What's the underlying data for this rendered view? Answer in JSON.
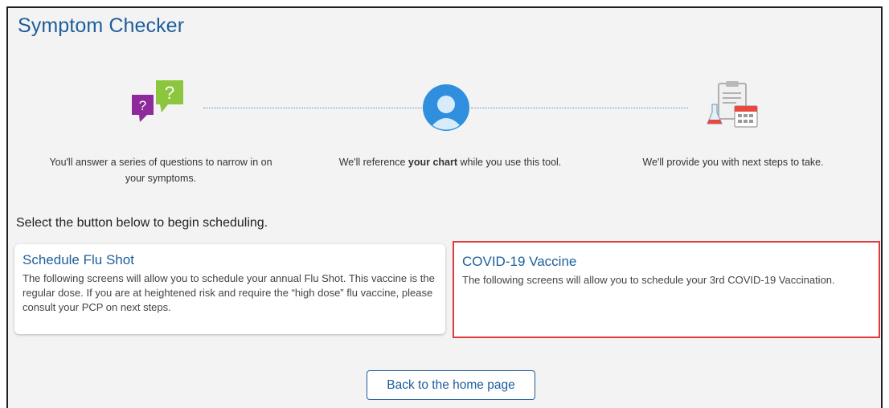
{
  "page": {
    "title": "Symptom Checker"
  },
  "steps": [
    {
      "icon": "question-bubbles-icon",
      "text": "You'll answer a series of questions to narrow in on your symptoms."
    },
    {
      "icon": "user-avatar-icon",
      "text_before": "We'll reference ",
      "text_bold": "your chart",
      "text_after": " while you use this tool."
    },
    {
      "icon": "clipboard-lab-calendar-icon",
      "text": "We'll provide you with next steps to take."
    }
  ],
  "prompt": "Select the button below to begin scheduling.",
  "cards": [
    {
      "title": "Schedule Flu Shot",
      "description": "The following screens will allow you to schedule your annual Flu Shot. This vaccine is the regular dose. If you are at heightened risk and require the “high dose” flu vaccine, please consult your PCP on next steps."
    },
    {
      "title": "COVID-19 Vaccine",
      "description": "The following screens will allow you to schedule your 3rd COVID-19 Vaccination."
    }
  ],
  "back_button": {
    "label": "Back to the home page"
  },
  "colors": {
    "accent": "#1d5e9c",
    "highlight_border": "#e0393e",
    "background": "#f3f3f3",
    "bubble_green": "#8cc63f",
    "bubble_purple": "#8e2a9b",
    "avatar_blue": "#2f8fde",
    "calendar_red": "#e8483e"
  }
}
